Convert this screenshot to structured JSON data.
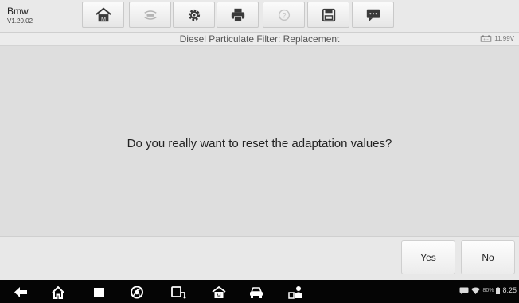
{
  "vehicle": {
    "make": "Bmw",
    "version": "V1.20.02"
  },
  "toolbar": {
    "icons": [
      "home-icon",
      "vehicle-swap-icon",
      "settings-icon",
      "print-icon",
      "help-icon",
      "save-icon",
      "data-logging-icon"
    ]
  },
  "screen": {
    "title": "Diesel Particulate Filter: Replacement",
    "battery_voltage": "11.99V"
  },
  "dialog": {
    "message": "Do you really want to reset the adaptation values?"
  },
  "actions": {
    "yes_label": "Yes",
    "no_label": "No"
  },
  "system_nav": {
    "icons": [
      "back-icon",
      "home-icon",
      "recent-apps-icon",
      "chrome-icon",
      "vci-icon",
      "maxisys-home-icon",
      "car-icon",
      "mechanic-icon"
    ]
  },
  "status_bar": {
    "battery_percent": "80%",
    "time": "8:25"
  }
}
